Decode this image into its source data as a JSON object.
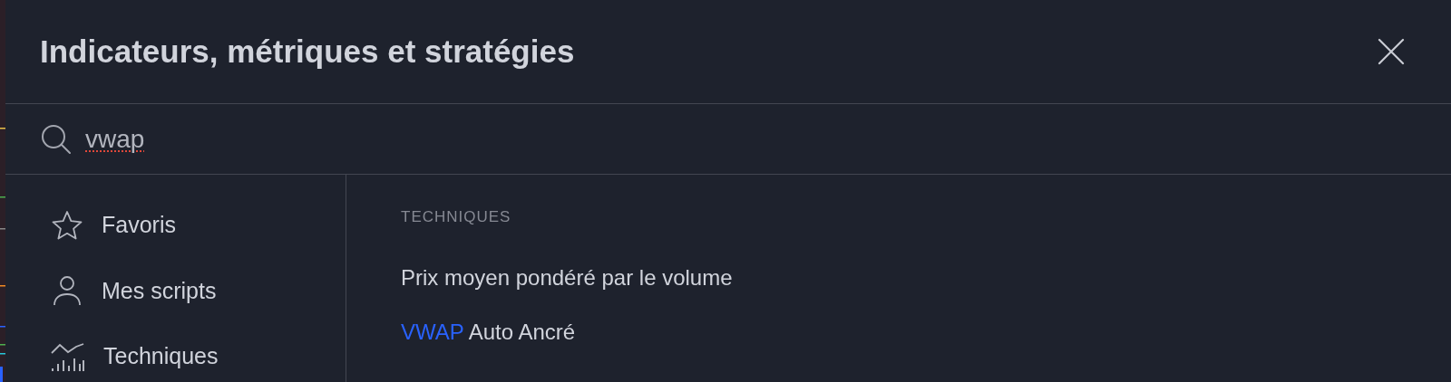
{
  "dialog": {
    "title": "Indicateurs, métriques et stratégies"
  },
  "search": {
    "value": "vwap",
    "spellcheck_error": true
  },
  "sidebar": {
    "items": [
      {
        "kind": "star",
        "label": "Favoris",
        "selected": false
      },
      {
        "kind": "person",
        "label": "Mes scripts",
        "selected": false
      },
      {
        "kind": "chart",
        "label": "Techniques",
        "selected": false
      }
    ]
  },
  "results": {
    "section": "TECHNIQUES",
    "items": [
      {
        "text": "Prix moyen pondéré par le volume"
      },
      {
        "highlight": "VWAP",
        "text": " Auto Ancré"
      }
    ]
  }
}
